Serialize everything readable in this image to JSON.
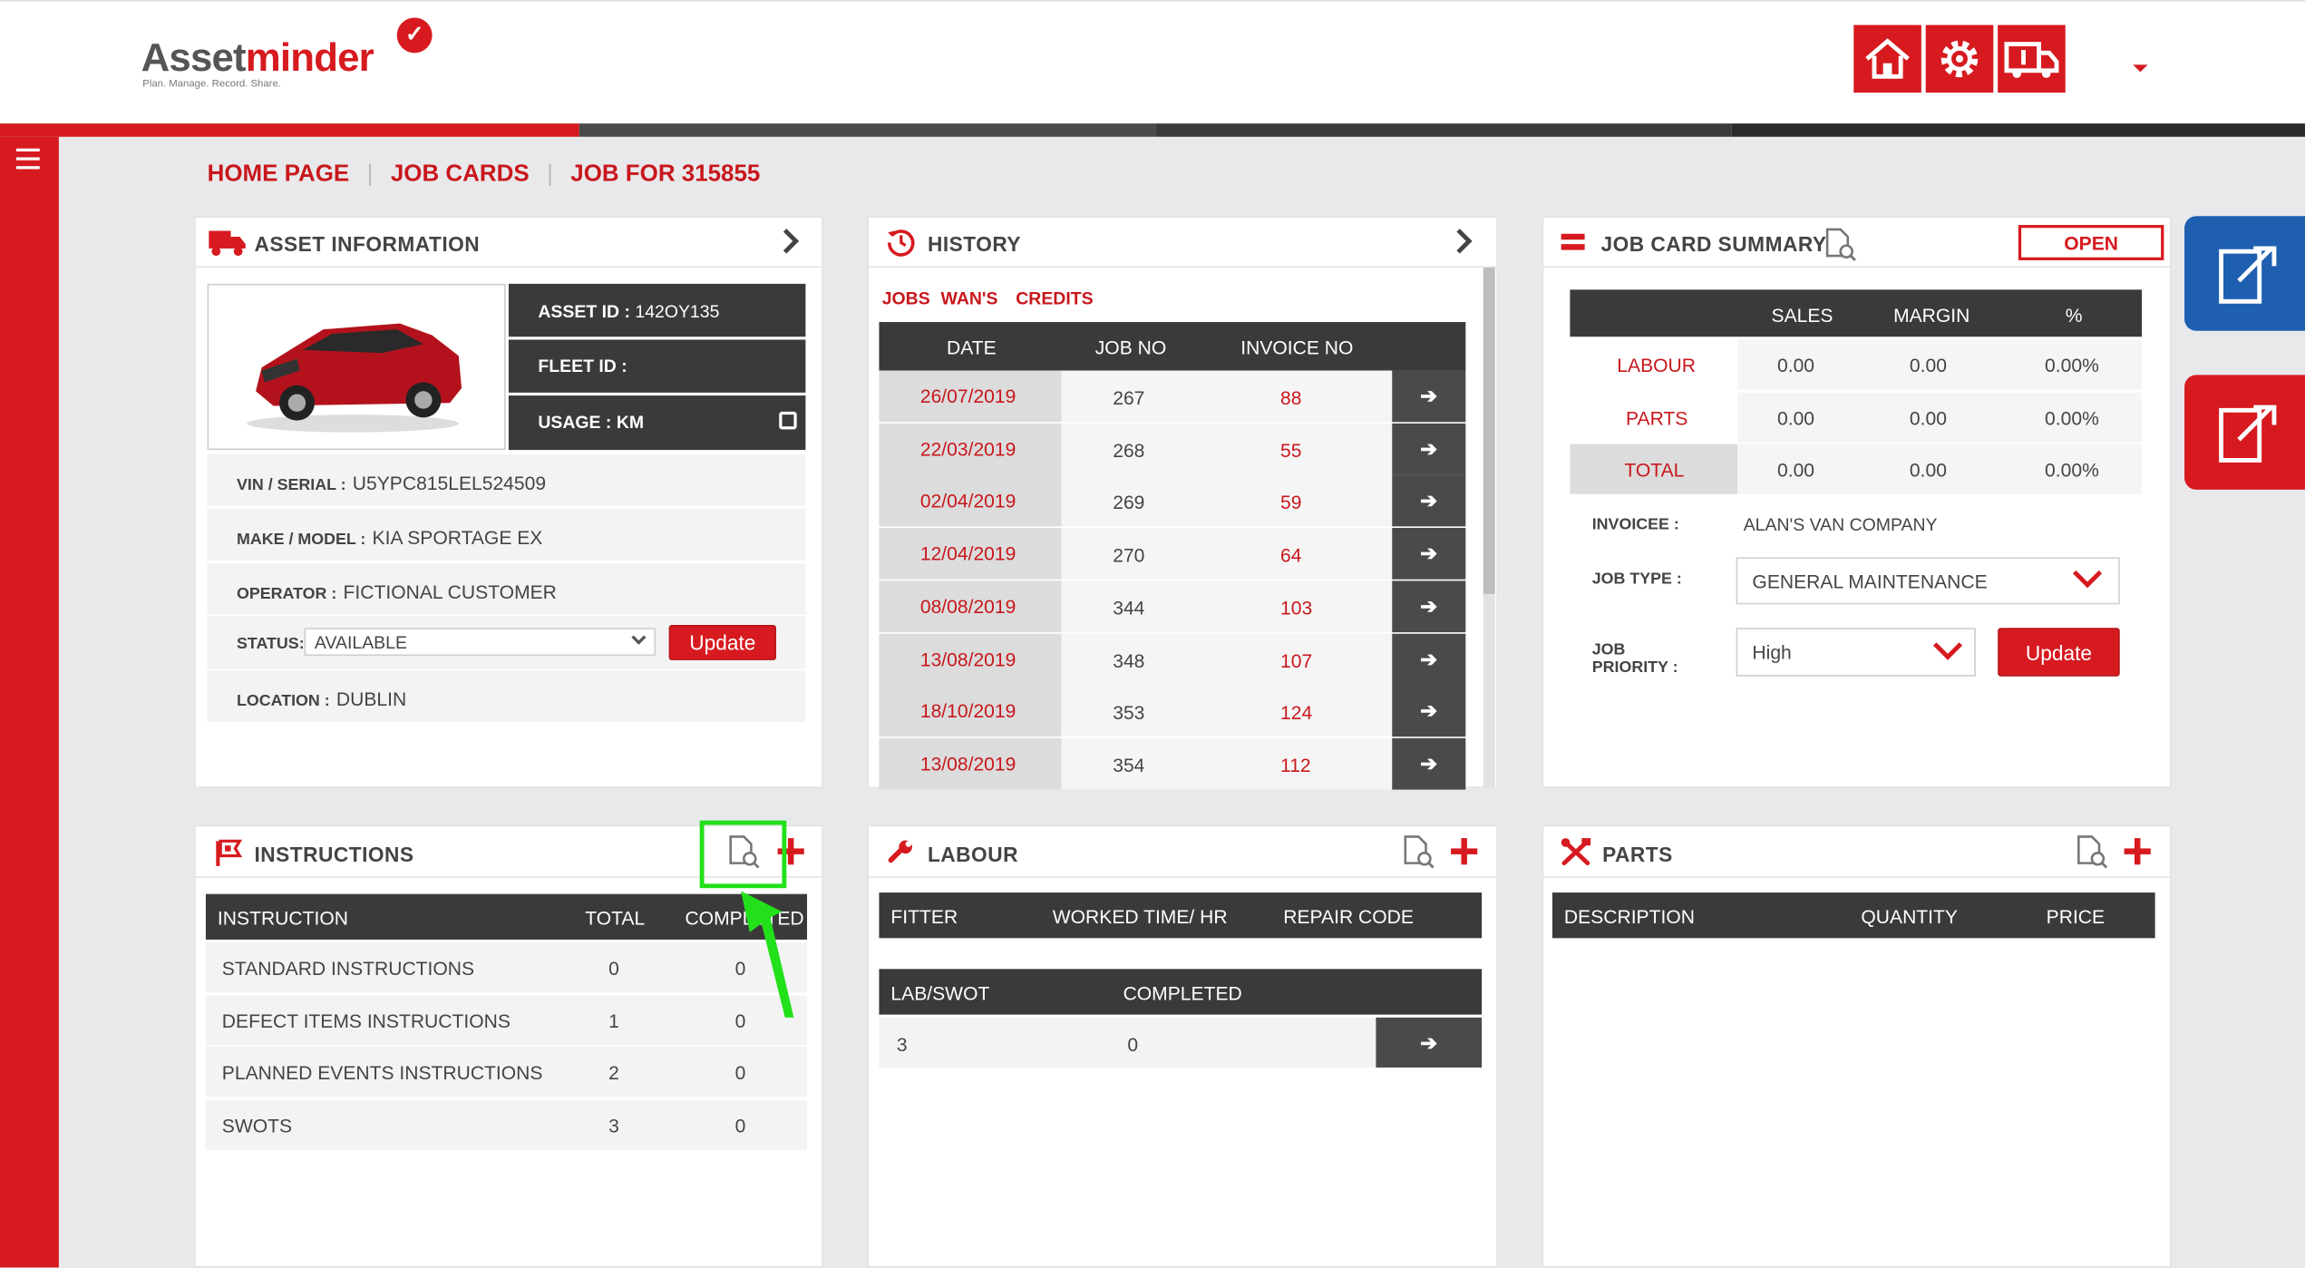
{
  "app": {
    "logo_part1": "Asset",
    "logo_part2": "minder",
    "logo_tagline": "Plan. Manage. Record. Share."
  },
  "colors": {
    "brand_red": "#d61a1f",
    "dark_header": "#3a3a3a",
    "blue_tab": "#1e5fb0",
    "highlight_green": "#22e01a"
  },
  "top_buttons": [
    "home-icon",
    "settings-gear-icon",
    "vehicle-info-icon"
  ],
  "breadcrumb": [
    "HOME PAGE",
    "JOB CARDS",
    "JOB FOR 315855"
  ],
  "asset_info": {
    "title": "ASSET INFORMATION",
    "asset_id_label": "ASSET ID :",
    "asset_id_value": "142OY135",
    "fleet_id_label": "FLEET ID :",
    "fleet_id_value": "",
    "usage_label": "USAGE : KM",
    "vin_label": "VIN / SERIAL :",
    "vin_value": "U5YPC815LEL524509",
    "make_label": "MAKE / MODEL :",
    "make_value": "KIA SPORTAGE EX",
    "operator_label": "OPERATOR :",
    "operator_value": "FICTIONAL CUSTOMER",
    "status_label": "STATUS:",
    "status_value": "AVAILABLE",
    "update_label": "Update",
    "location_label": "LOCATION :",
    "location_value": "DUBLIN"
  },
  "history": {
    "title": "HISTORY",
    "tabs": [
      "JOBS",
      "WAN'S",
      "CREDITS"
    ],
    "columns": [
      "DATE",
      "JOB NO",
      "INVOICE NO"
    ],
    "rows": [
      {
        "date": "26/07/2019",
        "job": "267",
        "invoice": "88"
      },
      {
        "date": "22/03/2019",
        "job": "268",
        "invoice": "55"
      },
      {
        "date": "02/04/2019",
        "job": "269",
        "invoice": "59"
      },
      {
        "date": "12/04/2019",
        "job": "270",
        "invoice": "64"
      },
      {
        "date": "08/08/2019",
        "job": "344",
        "invoice": "103"
      },
      {
        "date": "13/08/2019",
        "job": "348",
        "invoice": "107"
      },
      {
        "date": "18/10/2019",
        "job": "353",
        "invoice": "124"
      },
      {
        "date": "13/08/2019",
        "job": "354",
        "invoice": "112"
      }
    ]
  },
  "summary": {
    "title": "JOB CARD SUMMARY",
    "status": "OPEN",
    "columns": [
      "SALES",
      "MARGIN",
      "%"
    ],
    "rows": [
      {
        "label": "LABOUR",
        "sales": "0.00",
        "margin": "0.00",
        "pct": "0.00%"
      },
      {
        "label": "PARTS",
        "sales": "0.00",
        "margin": "0.00",
        "pct": "0.00%"
      },
      {
        "label": "TOTAL",
        "sales": "0.00",
        "margin": "0.00",
        "pct": "0.00%"
      }
    ],
    "invoicee_label": "INVOICEE :",
    "invoicee_value": "ALAN'S VAN COMPANY",
    "job_type_label": "JOB TYPE :",
    "job_type_value": "GENERAL MAINTENANCE",
    "priority_label_1": "JOB",
    "priority_label_2": "PRIORITY :",
    "priority_value": "High",
    "update_label": "Update"
  },
  "instructions": {
    "title": "INSTRUCTIONS",
    "columns": [
      "INSTRUCTION",
      "TOTAL",
      "COMPLETED"
    ],
    "rows": [
      {
        "name": "STANDARD INSTRUCTIONS",
        "total": "0",
        "completed": "0"
      },
      {
        "name": "DEFECT ITEMS INSTRUCTIONS",
        "total": "1",
        "completed": "0"
      },
      {
        "name": "PLANNED EVENTS INSTRUCTIONS",
        "total": "2",
        "completed": "0"
      },
      {
        "name": "SWOTS",
        "total": "3",
        "completed": "0"
      }
    ]
  },
  "labour": {
    "title": "LABOUR",
    "columns": [
      "FITTER",
      "WORKED TIME/ HR",
      "REPAIR CODE"
    ],
    "columns2": [
      "LAB/SWOT",
      "COMPLETED"
    ],
    "row": {
      "lab_swot": "3",
      "completed": "0"
    }
  },
  "parts": {
    "title": "PARTS",
    "columns": [
      "DESCRIPTION",
      "QUANTITY",
      "PRICE"
    ]
  }
}
